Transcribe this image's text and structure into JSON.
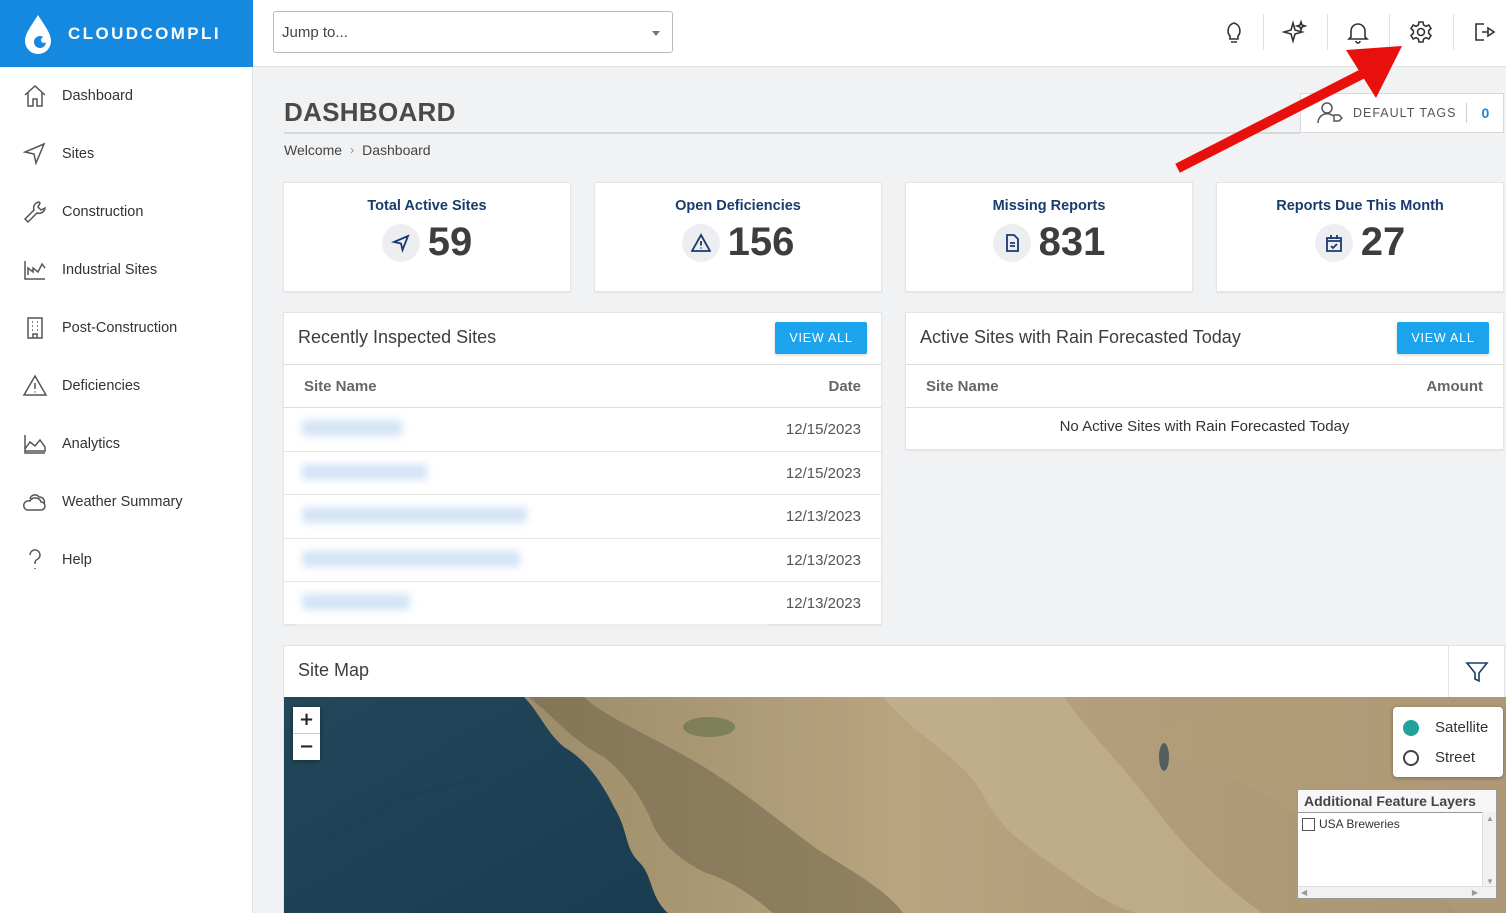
{
  "brand": {
    "name": "CLOUDCOMPLI",
    "color": "#1589e0"
  },
  "sidebar": {
    "items": [
      {
        "label": "Dashboard",
        "icon": "home-icon"
      },
      {
        "label": "Sites",
        "icon": "navigation-icon"
      },
      {
        "label": "Construction",
        "icon": "wrench-icon"
      },
      {
        "label": "Industrial Sites",
        "icon": "factory-icon"
      },
      {
        "label": "Post-Construction",
        "icon": "building-icon"
      },
      {
        "label": "Deficiencies",
        "icon": "warning-icon"
      },
      {
        "label": "Analytics",
        "icon": "area-chart-icon"
      },
      {
        "label": "Weather Summary",
        "icon": "cloud-icon"
      },
      {
        "label": "Help",
        "icon": "help-icon"
      }
    ]
  },
  "topbar": {
    "jump_placeholder": "Jump to...",
    "icons": [
      "lightbulb-icon",
      "sparkle-icon",
      "bell-icon",
      "gear-icon",
      "logout-icon"
    ]
  },
  "header": {
    "title": "DASHBOARD",
    "breadcrumb": [
      "Welcome",
      "Dashboard"
    ],
    "default_tags_label": "DEFAULT TAGS",
    "default_tags_count": "0"
  },
  "stats": [
    {
      "title": "Total Active Sites",
      "value": "59",
      "icon": "navigation-icon"
    },
    {
      "title": "Open Deficiencies",
      "value": "156",
      "icon": "warning-icon"
    },
    {
      "title": "Missing Reports",
      "value": "831",
      "icon": "document-icon"
    },
    {
      "title": "Reports Due This Month",
      "value": "27",
      "icon": "calendar-check-icon"
    }
  ],
  "recent_sites": {
    "title": "Recently Inspected Sites",
    "view_all": "VIEW ALL",
    "columns": [
      "Site Name",
      "Date"
    ],
    "rows": [
      {
        "date": "12/15/2023"
      },
      {
        "date": "12/15/2023"
      },
      {
        "date": "12/13/2023"
      },
      {
        "date": "12/13/2023"
      },
      {
        "date": "12/13/2023"
      }
    ]
  },
  "rain_sites": {
    "title": "Active Sites with Rain Forecasted Today",
    "view_all": "VIEW ALL",
    "columns": [
      "Site Name",
      "Amount"
    ],
    "empty": "No Active Sites with Rain Forecasted Today"
  },
  "site_map": {
    "title": "Site Map",
    "zoom_in": "+",
    "zoom_out": "−",
    "layers": [
      "Satellite",
      "Street"
    ],
    "selected_layer": "Satellite",
    "feature_layers_title": "Additional Feature Layers",
    "feature_layers": [
      "USA Breweries"
    ]
  },
  "colors": {
    "accent": "#1ba3ec",
    "navy": "#1a3b6e",
    "annotation": "#e8100d"
  }
}
